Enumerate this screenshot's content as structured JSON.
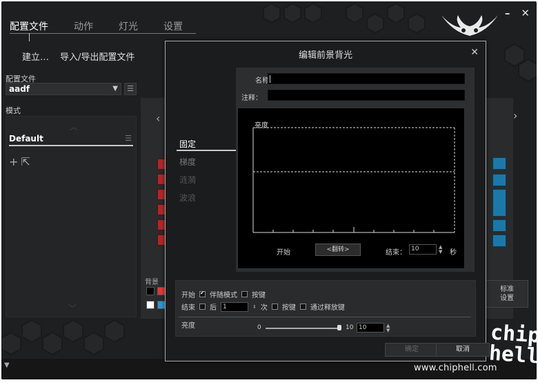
{
  "window": {
    "minimize": "–",
    "close": "✕"
  },
  "nav": {
    "tabs": [
      {
        "label": "配置文件",
        "active": true
      },
      {
        "label": "动作",
        "active": false
      },
      {
        "label": "灯光",
        "active": false
      },
      {
        "label": "设置",
        "active": false
      }
    ],
    "sub": [
      "建立…",
      "导入/导出配置文件"
    ]
  },
  "profile": {
    "label": "配置文件",
    "selected": "aadf",
    "menu_icon": "list-icon"
  },
  "mode": {
    "label": "模式",
    "items": [
      "Default"
    ]
  },
  "keyboard": {
    "prev_icon": "chevron-left-icon",
    "next_icon": "chevron-right-icon",
    "background_label": "背景",
    "swatches": [
      "#000000",
      "#e23a3a",
      "#ffffff",
      "#2e95d8"
    ],
    "standard_button": [
      "标准",
      "设置"
    ],
    "accent_red": "#b0282a",
    "accent_blue": "#1d78a8"
  },
  "dialog": {
    "title": "编辑前景背光",
    "close": "✕",
    "side_tabs": [
      {
        "label": "固定",
        "state": "active"
      },
      {
        "label": "梯度",
        "state": "normal"
      },
      {
        "label": "涟漪",
        "state": "disabled"
      },
      {
        "label": "波浪",
        "state": "disabled"
      }
    ],
    "name_label": "名称:",
    "name_value": "",
    "note_label": "注释：",
    "note_value": "",
    "graph": {
      "ylabel": "亮度"
    },
    "flow": {
      "start_label": "开始",
      "flip_button": "<翻转>",
      "end_label": "结束：",
      "end_value": "10",
      "unit": "秒"
    },
    "start_row": {
      "label": "开始",
      "options": [
        {
          "label": "伴随模式",
          "checked": true
        },
        {
          "label": "按键",
          "checked": false
        }
      ]
    },
    "end_row": {
      "label": "结束",
      "after_label": "后",
      "after_value": "1",
      "times_label": "次",
      "options": [
        {
          "label": "按键",
          "checked": false
        },
        {
          "label": "通过释放键",
          "checked": false
        }
      ]
    },
    "brightness": {
      "label": "亮度",
      "min": "0",
      "max": "10",
      "value": "10"
    },
    "ok_button": "确定",
    "cancel_button": "取消"
  },
  "watermark": {
    "site": "www.chiphell.com",
    "mark": "chip\nhell"
  }
}
